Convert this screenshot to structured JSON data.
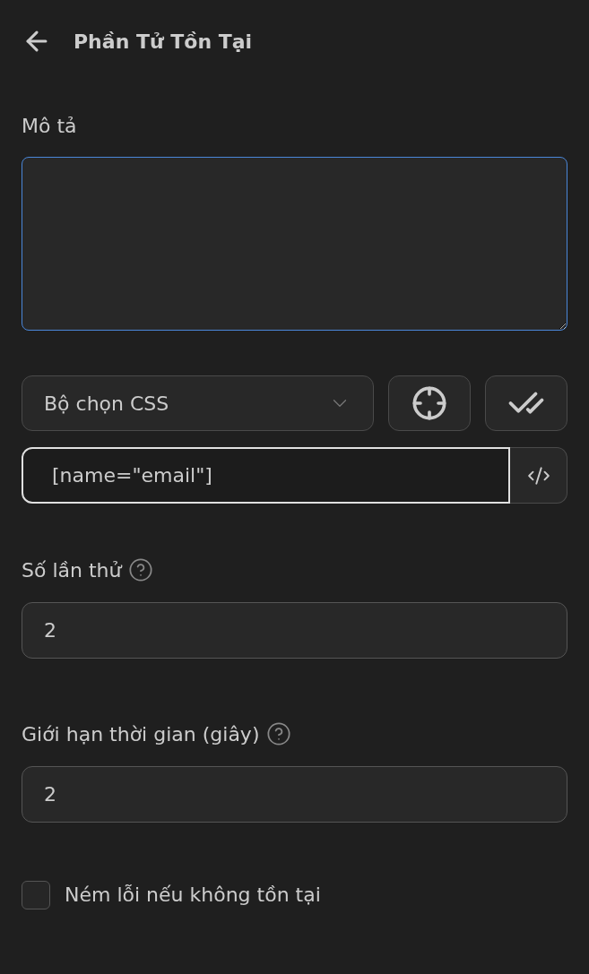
{
  "header": {
    "title": "Phần Tử Tồn Tại"
  },
  "description": {
    "label": "Mô tả",
    "focused": true
  },
  "selector": {
    "type": "Bộ chọn CSS",
    "value": "[name=\"email\"]"
  },
  "fields": [
    {
      "label": "Số lần thử",
      "value": "2"
    },
    {
      "label": "Giới hạn thời gian (giây)",
      "value": "2"
    }
  ],
  "option": {
    "label": "Ném lỗi nếu không tồn tại",
    "checked": false
  }
}
